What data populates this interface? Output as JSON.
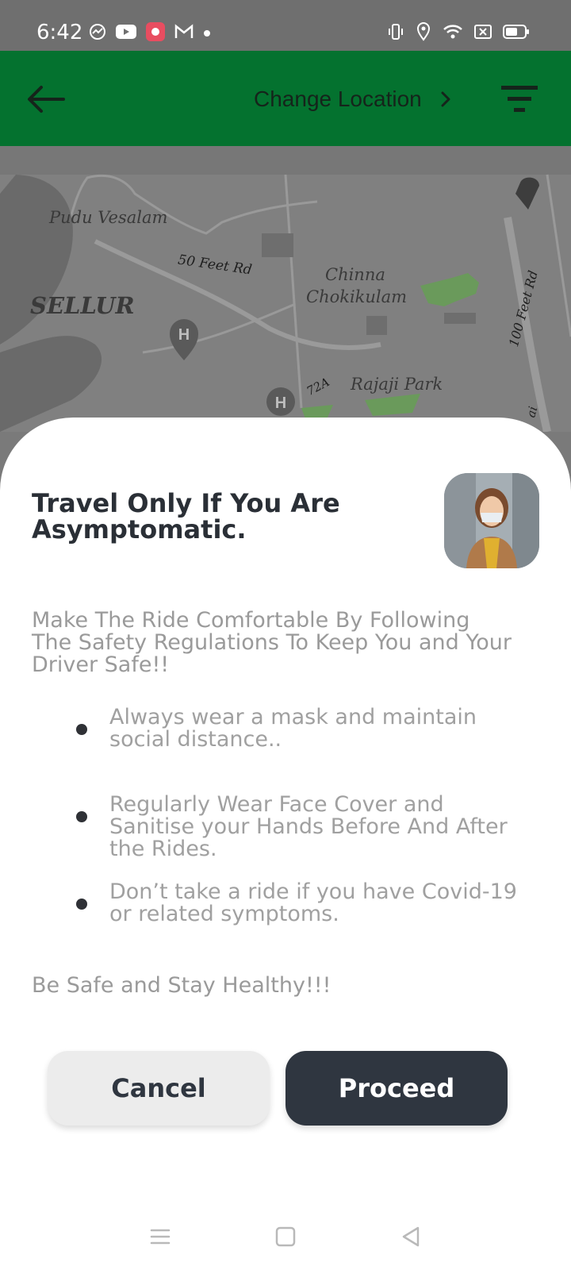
{
  "status_bar": {
    "time": "6:42",
    "left_icons": [
      "messenger-icon",
      "youtube-icon",
      "app-icon",
      "gmail-icon",
      "dot-icon"
    ],
    "right_icons": [
      "vibrate-icon",
      "location-icon",
      "wifi-icon",
      "close-box-icon",
      "battery-icon"
    ]
  },
  "header": {
    "background_color": "#04722f",
    "change_location_label": "Change Location"
  },
  "map": {
    "labels": {
      "pudu_vesalam": "Pudu Vesalam",
      "sellur": "SELLUR",
      "feet_rd_50": "50 Feet Rd",
      "chinna_1": "Chinna",
      "chinna_2": "Chokikulam",
      "rajaji_park": "Rajaji Park",
      "route_72a": "72A",
      "feet_rd_100": "100 Feet Rd",
      "edge_text": "ai"
    }
  },
  "sheet": {
    "title": "Travel Only If You Are Asymptomatic.",
    "intro_line1": "Make The Ride Comfortable By Following",
    "intro_line2": "The Safety Regulations To Keep You and Your",
    "intro_line3": "Driver Safe!!",
    "bullets": [
      "Always wear a mask and maintain social distance..",
      "Regularly Wear Face Cover and Sanitise your Hands Before And After the Rides.",
      "Don’t take a ride if you have Covid-19 or related symptoms."
    ],
    "closing": "Be Safe and Stay Healthy!!!",
    "cancel_label": "Cancel",
    "proceed_label": "Proceed"
  },
  "colors": {
    "title_text": "#2a2f36",
    "body_text": "#9a9a9a",
    "proceed_bg": "#2f3640",
    "cancel_bg": "#ececec"
  }
}
